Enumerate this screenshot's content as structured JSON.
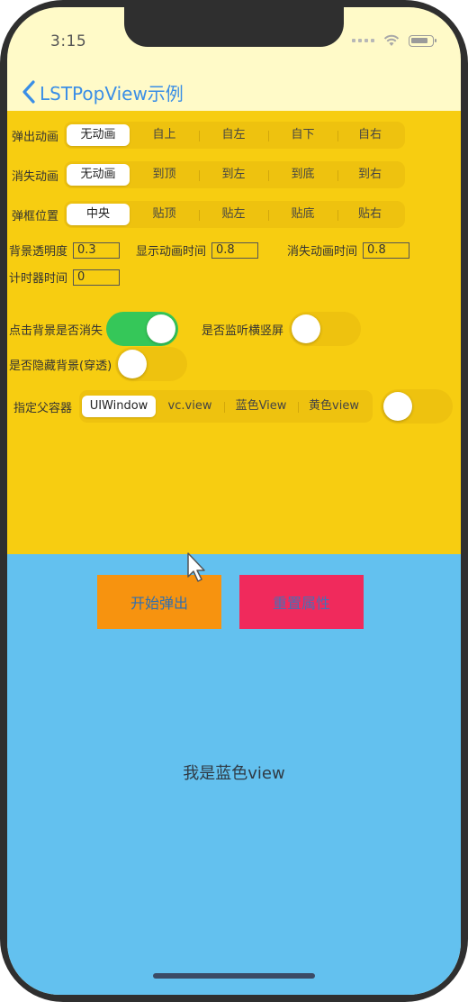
{
  "status_bar": {
    "time": "3:15"
  },
  "nav": {
    "back_title": "LSTPopView示例"
  },
  "rows": {
    "popup_animation": {
      "label": "弹出动画",
      "options": [
        "无动画",
        "自上",
        "自左",
        "自下",
        "自右"
      ],
      "selected": 0
    },
    "dismiss_animation": {
      "label": "消失动画",
      "options": [
        "无动画",
        "到顶",
        "到左",
        "到底",
        "到右"
      ],
      "selected": 0
    },
    "popup_position": {
      "label": "弹框位置",
      "options": [
        "中央",
        "贴顶",
        "贴左",
        "贴底",
        "贴右"
      ],
      "selected": 0
    }
  },
  "fields": {
    "bg_opacity": {
      "label": "背景透明度",
      "value": "0.3"
    },
    "show_duration": {
      "label": "显示动画时间",
      "value": "0.8"
    },
    "dismiss_duration": {
      "label": "消失动画时间",
      "value": "0.8"
    },
    "timer": {
      "label": "计时器时间",
      "value": "0"
    }
  },
  "toggles": {
    "tap_bg_dismiss": {
      "label": "点击背景是否消失",
      "on": true
    },
    "listen_orientation": {
      "label": "是否监听横竖屏",
      "on": false
    },
    "hide_bg": {
      "label": "是否隐藏背景(穿透)",
      "on": false
    },
    "parent_switch": {
      "on": false
    }
  },
  "parent_container": {
    "label": "指定父容器",
    "options": [
      "UIWindow",
      "vc.view",
      "蓝色View",
      "黄色view"
    ],
    "selected": 0
  },
  "buttons": {
    "start": "开始弹出",
    "attributes": "重置属性"
  },
  "blue_view": {
    "label": "我是蓝色view"
  },
  "colors": {
    "nav_background": "#fffac8",
    "panel_yellow": "#f7cd11",
    "blue_view": "#63c1ef",
    "start_button": "#f7930f",
    "reset_button": "#f02a5c",
    "switch_on": "#35c759"
  }
}
